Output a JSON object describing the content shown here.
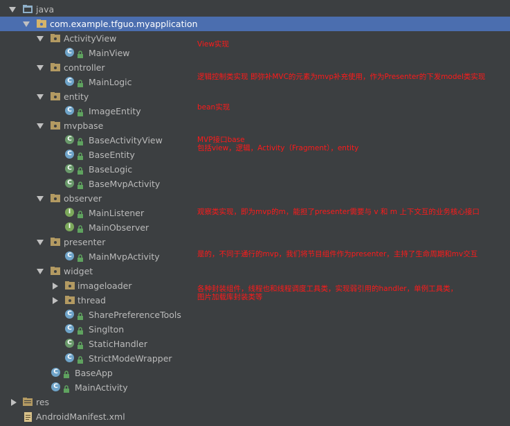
{
  "tree": {
    "root": "java",
    "package": "com.example.tfguo.myapplication",
    "folders": {
      "activityview": "ActivityView",
      "controller": "controller",
      "entity": "entity",
      "mvpbase": "mvpbase",
      "observer": "observer",
      "presenter": "presenter",
      "widget": "widget",
      "imageloader": "imageloader",
      "thread": "thread",
      "res": "res"
    },
    "files": {
      "mainview": "MainView",
      "mainlogic": "MainLogic",
      "imageentity": "ImageEntity",
      "baseactivityview": "BaseActivityView",
      "baseentity": "BaseEntity",
      "baselogic": "BaseLogic",
      "basemvpactivity": "BaseMvpActivity",
      "mainlistener": "MainListener",
      "mainobserver": "MainObserver",
      "mainmvpactivity": "MainMvpActivity",
      "sharepreferencetools": "SharePreferenceTools",
      "singlton": "Singlton",
      "statichandler": "StaticHandler",
      "strictmodewrapper": "StrictModeWrapper",
      "baseapp": "BaseApp",
      "mainactivity": "MainActivity",
      "manifest": "AndroidManifest.xml"
    }
  },
  "notes": {
    "view": "View实现",
    "controller": "逻辑控制类实现  即弥补MVC的元素为mvp补充使用，作为Presenter的下发model类实现",
    "entity": "bean实现",
    "mvpbase_1": "MVP接口base",
    "mvpbase_2": "包括view，逻辑，Activity（Fragment），entity",
    "observer": "观察类实现，即为mvp的m，能担了presenter需要与 v 和 m 上下文互的业务核心接口",
    "presenter": "是的，不同于通行的mvp，我们将节目组件作为presenter，主持了生命周期和mv交互",
    "widget_1": "各种封装组件，线程也和线程调度工具类，实现弱引用的handler，单例工具类，",
    "widget_2": "图片加载库封装类等"
  },
  "colors": {
    "background": "#3c3f41",
    "selection": "#4b6eaf",
    "text": "#bbbbbb",
    "annotation": "#ff1a1a",
    "class_icon": "#6fa4c9",
    "interface_icon": "#7ca95b"
  },
  "icons": {
    "folder": "folder-icon",
    "package": "package-folder-icon",
    "class": "class-c-icon",
    "interface": "interface-i-icon",
    "lock": "lock-icon",
    "expanded": "arrow-down-icon",
    "collapsed": "arrow-right-icon"
  }
}
